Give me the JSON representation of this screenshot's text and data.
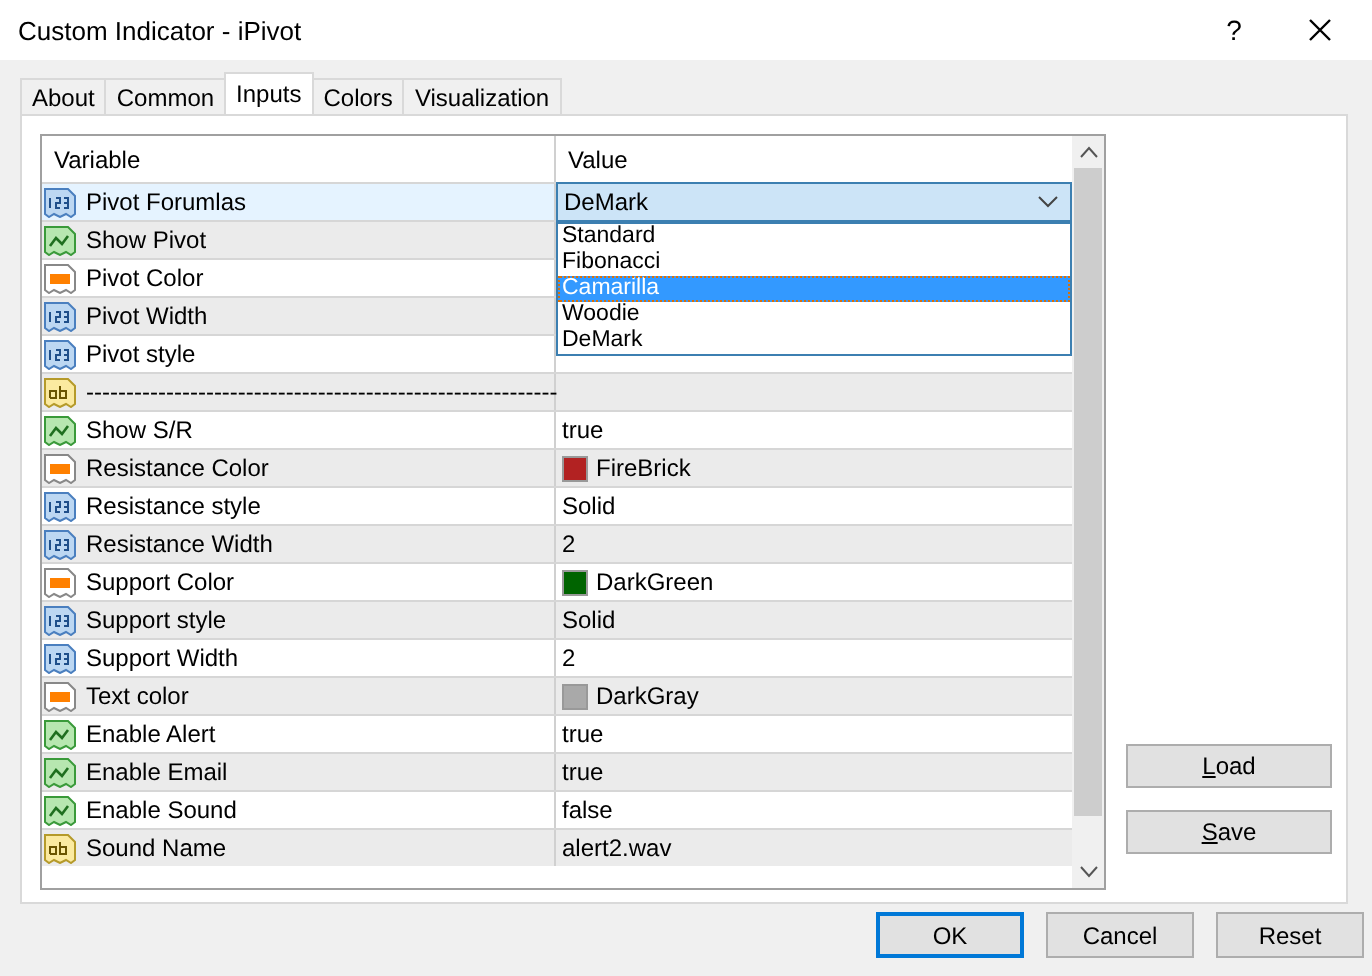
{
  "window": {
    "title": "Custom Indicator - iPivot",
    "help": "?"
  },
  "tabs": [
    {
      "label": "About",
      "selected": false
    },
    {
      "label": "Common",
      "selected": false
    },
    {
      "label": "Inputs",
      "selected": true
    },
    {
      "label": "Colors",
      "selected": false
    },
    {
      "label": "Visualization",
      "selected": false
    }
  ],
  "table": {
    "columns": [
      "Variable",
      "Value"
    ],
    "rows": [
      {
        "kind": "int",
        "variable": "Pivot Forumlas",
        "value": "DeMark",
        "selected": true,
        "dropdown": {
          "options": [
            {
              "label": "Standard",
              "selected": false
            },
            {
              "label": "Fibonacci",
              "selected": false
            },
            {
              "label": "Camarilla",
              "selected": true
            },
            {
              "label": "Woodie",
              "selected": false
            },
            {
              "label": "DeMark",
              "selected": false
            }
          ]
        }
      },
      {
        "kind": "bool",
        "variable": "Show Pivot",
        "selected": false
      },
      {
        "kind": "color",
        "variable": "Pivot Color",
        "selected": false
      },
      {
        "kind": "int",
        "variable": "Pivot Width",
        "selected": false
      },
      {
        "kind": "int",
        "variable": "Pivot style",
        "selected": false
      },
      {
        "kind": "string",
        "variable": "-----------------------------------------------------------",
        "selected": false
      },
      {
        "kind": "bool",
        "variable": "Show S/R",
        "value": "true",
        "selected": false
      },
      {
        "kind": "color",
        "variable": "Resistance Color",
        "value": "FireBrick",
        "color": "#b22222",
        "selected": false
      },
      {
        "kind": "int",
        "variable": "Resistance style",
        "value": "Solid",
        "selected": false
      },
      {
        "kind": "int",
        "variable": "Resistance Width",
        "value": "2",
        "selected": false
      },
      {
        "kind": "color",
        "variable": "Support Color",
        "value": "DarkGreen",
        "color": "#006400",
        "selected": false
      },
      {
        "kind": "int",
        "variable": "Support style",
        "value": "Solid",
        "selected": false
      },
      {
        "kind": "int",
        "variable": "Support Width",
        "value": "2",
        "selected": false
      },
      {
        "kind": "color",
        "variable": "Text color",
        "value": "DarkGray",
        "color": "#a9a9a9",
        "selected": false
      },
      {
        "kind": "bool",
        "variable": "Enable Alert",
        "value": "true",
        "selected": false
      },
      {
        "kind": "bool",
        "variable": "Enable Email",
        "value": "true",
        "selected": false
      },
      {
        "kind": "bool",
        "variable": "Enable Sound",
        "value": "false",
        "selected": false
      },
      {
        "kind": "string",
        "variable": "Sound Name",
        "value": "alert2.wav",
        "selected": false
      }
    ]
  },
  "side_buttons": [
    "Load",
    "Save"
  ],
  "buttons": [
    "OK",
    "Cancel",
    "Reset"
  ]
}
